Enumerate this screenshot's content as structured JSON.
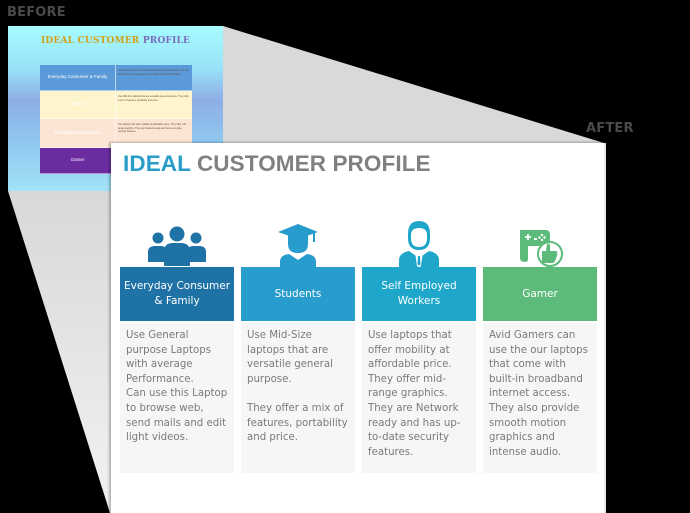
{
  "labels": {
    "before": "BEFORE",
    "after": "AFTER"
  },
  "colors": {
    "background": "#000000",
    "before_title_word1": "#d4a017",
    "before_title_word2": "#7a6bbd",
    "after_title_accent": "#2a9cc8",
    "after_title_rest": "#808080",
    "card_headers": [
      "#1f72a5",
      "#279ccd",
      "#1fa7cb",
      "#5cbb7a"
    ]
  },
  "before_slide": {
    "title_word1": "IDEAL CUSTOMER",
    "title_word2": "PROFILE",
    "rows": [
      {
        "label": "Everyday Consumer & Family",
        "text": "Use General purpose Laptops with average Performance. Can use this Laptop to browse web, send mails and edit light videos."
      },
      {
        "label": "Students",
        "text": "Use Mid-Size laptops that are versatile general purpose. They offer a mix of features, portability and price."
      },
      {
        "label": "Self Employed Workers",
        "text": "Use laptops that offer mobility at affordable price. They offer mid-range graphics. They are Network ready and has up-to-date security features."
      },
      {
        "label": "Gamer",
        "text": ""
      }
    ]
  },
  "after_slide": {
    "title_word1": "IDEAL",
    "title_word2": "CUSTOMER PROFILE",
    "cards": [
      {
        "icon": "family-group-icon",
        "title": "Everyday Consumer & Family",
        "description": "Use General purpose Laptops with average Performance.\nCan use this Laptop to browse web, send mails and edit light videos."
      },
      {
        "icon": "graduate-student-icon",
        "title": "Students",
        "description": "Use Mid-Size laptops that are versatile general purpose.\n\nThey offer a mix of features, portability and price."
      },
      {
        "icon": "business-worker-icon",
        "title": "Self Employed Workers",
        "description": "Use laptops that offer mobility at affordable price.\nThey offer mid-range graphics.\nThey are Network ready and has up-to-date security features."
      },
      {
        "icon": "gamepad-thumbs-up-icon",
        "title": "Gamer",
        "description": "Avid Gamers can use the our laptops that come with built-in broadband internet access.\nThey also provide smooth motion graphics and intense audio."
      }
    ]
  }
}
